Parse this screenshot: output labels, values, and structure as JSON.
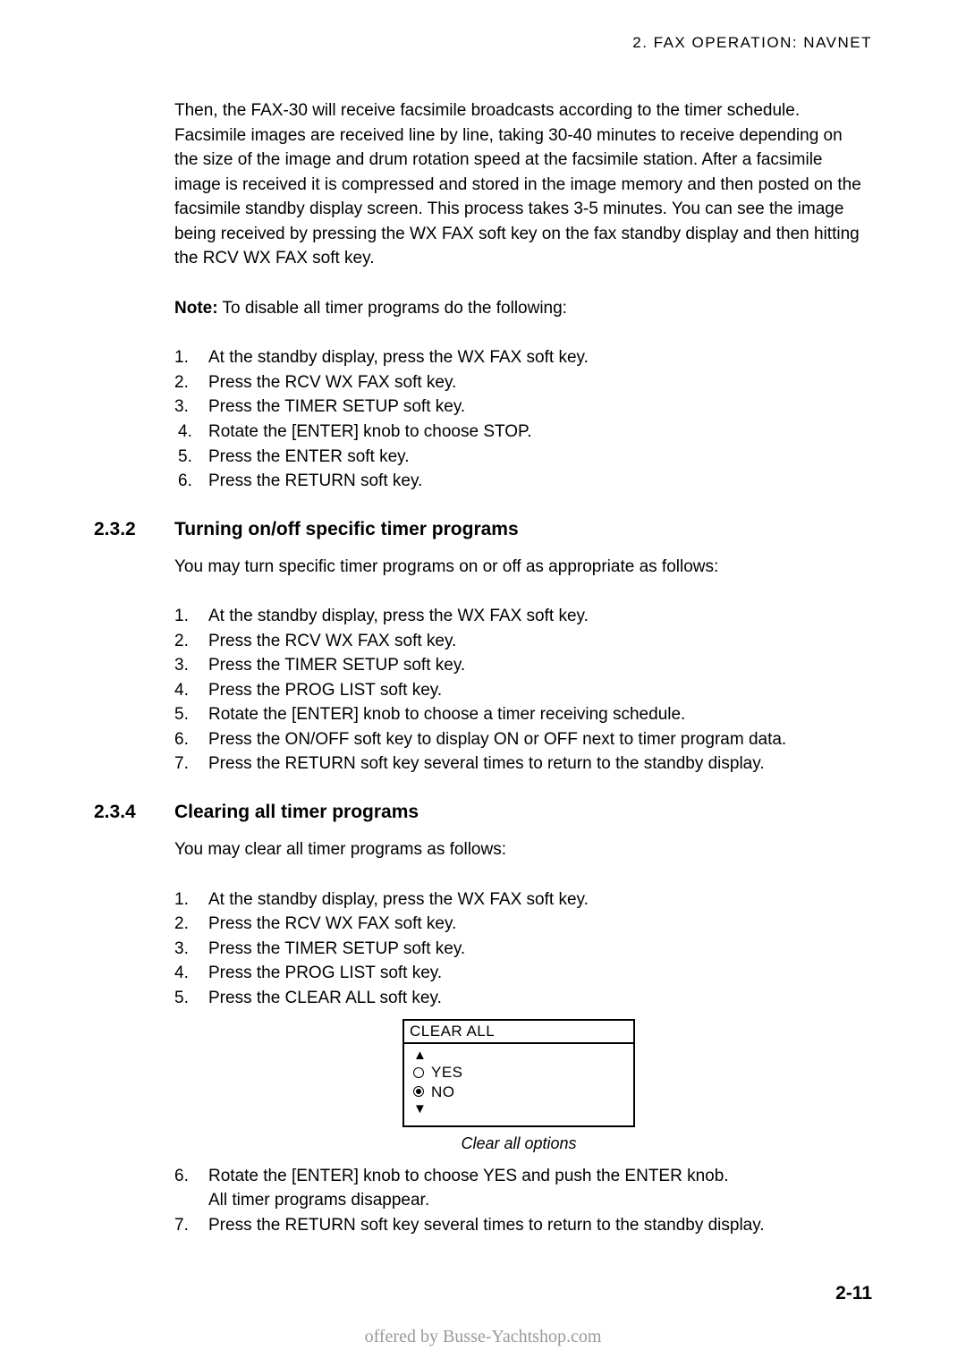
{
  "header": "2. FAX OPERATION: NAVNET",
  "intro_para": "Then, the FAX-30 will receive facsimile broadcasts according to the timer schedule. Facsimile images are received line by line, taking 30-40 minutes to receive depending on the size of the image and drum rotation speed at the facsimile station. After a facsimile image is received it is compressed and stored in the image memory and then posted on the facsimile standby display screen. This process takes 3-5 minutes. You can see the image being received by pressing the WX FAX soft key on the fax standby display and then hitting the RCV WX FAX soft key.",
  "note_label": "Note:",
  "note_text": " To disable all timer programs do the following:",
  "disable_steps": [
    "At the standby display, press the WX FAX soft key.",
    "Press the RCV WX FAX soft key.",
    "Press the TIMER SETUP soft key.",
    "Rotate the [ENTER] knob to choose STOP.",
    "Press the ENTER soft key.",
    "Press the RETURN soft key."
  ],
  "section232_num": "2.3.2",
  "section232_title": "Turning on/off specific timer programs",
  "section232_intro": "You may turn specific timer programs on or off as appropriate as follows:",
  "section232_steps": [
    "At the standby display, press the WX FAX soft key.",
    "Press the RCV WX FAX soft key.",
    "Press the TIMER SETUP soft key.",
    "Press the PROG LIST soft key.",
    "Rotate the [ENTER] knob to choose a timer receiving schedule.",
    "Press the ON/OFF soft key to display ON or OFF next to timer program data.",
    "Press the RETURN soft key several times to return to the standby display."
  ],
  "section234_num": "2.3.4",
  "section234_title": "Clearing all timer programs",
  "section234_intro": "You may clear all timer programs as follows:",
  "section234_steps_a": [
    "At the standby display, press the WX FAX soft key.",
    "Press the RCV WX FAX soft key.",
    "Press the TIMER SETUP soft key.",
    "Press the PROG LIST soft key.",
    "Press the CLEAR ALL soft key."
  ],
  "figure": {
    "title": "CLEAR ALL",
    "option_yes": "YES",
    "option_no": "NO",
    "caption": "Clear all options"
  },
  "section234_step6": "Rotate the [ENTER] knob to choose YES and push the ENTER knob.",
  "section234_step6_sub": "All timer programs disappear.",
  "section234_step7": "Press the RETURN soft key several times to return to the standby display.",
  "page_number": "2-11",
  "footer": "offered by Busse-Yachtshop.com"
}
